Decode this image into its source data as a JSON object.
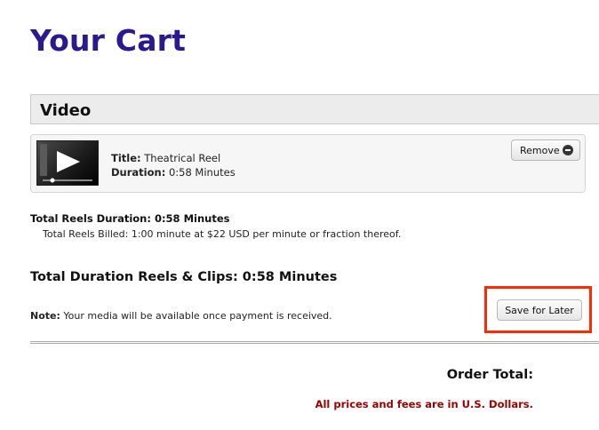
{
  "page": {
    "title": "Your Cart"
  },
  "section": {
    "title": "Video"
  },
  "item": {
    "title_label": "Title:",
    "title_value": "Theatrical Reel",
    "duration_label": "Duration:",
    "duration_value": "0:58 Minutes",
    "remove_label": "Remove",
    "thumbnail_icon": "video-play-icon"
  },
  "summary": {
    "reels_duration": "Total Reels Duration: 0:58 Minutes",
    "reels_billed": "Total Reels Billed: 1:00 minute at $22 USD per minute or fraction thereof.",
    "total_duration": "Total Duration Reels & Clips: 0:58 Minutes",
    "note_label": "Note:",
    "note_text": "Your media will be available once payment is received.",
    "save_label": "Save for Later",
    "order_total_label": "Order Total:",
    "currency_note": "All prices and fees are in U.S. Dollars."
  },
  "colors": {
    "title": "#2b1a8f",
    "highlight": "#ff2a00",
    "currency_note": "#9b0000"
  }
}
